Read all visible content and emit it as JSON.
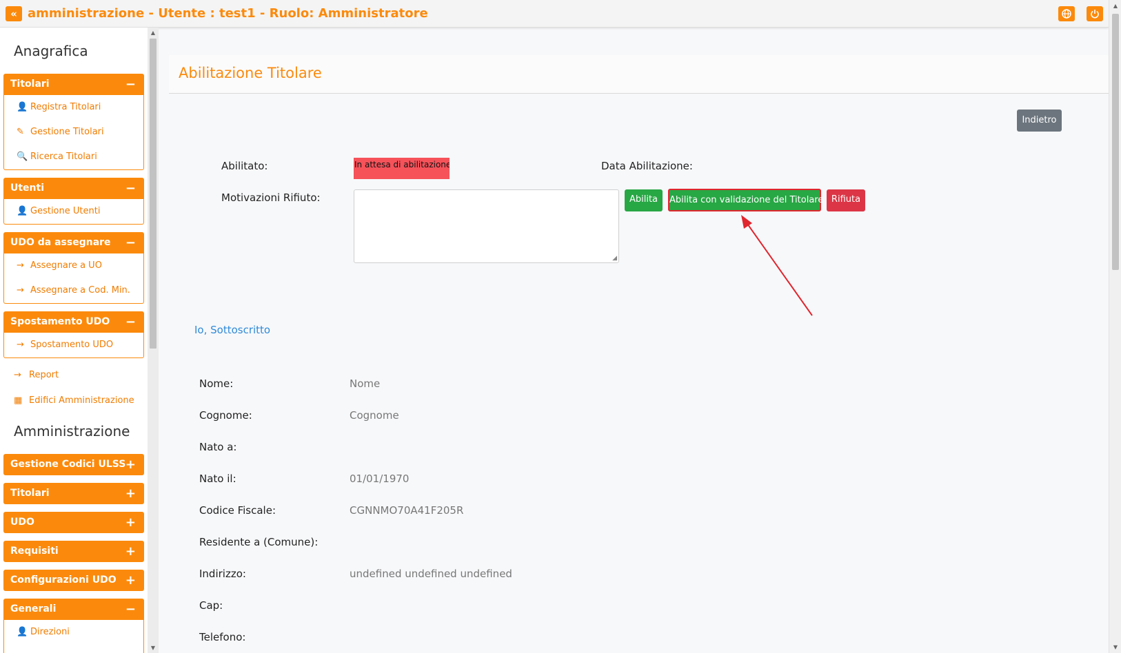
{
  "header": {
    "title": "amministrazione - Utente : test1 - Ruolo: Amministratore",
    "collapse_icon": "«"
  },
  "sidebar": {
    "section1": "Anagrafica",
    "section2": "Amministrazione",
    "groups": [
      {
        "title": "Titolari",
        "sign": "−",
        "items": [
          "Registra Titolari",
          "Gestione Titolari",
          "Ricerca Titolari"
        ]
      },
      {
        "title": "Utenti",
        "sign": "−",
        "items": [
          "Gestione Utenti"
        ]
      },
      {
        "title": "UDO da assegnare",
        "sign": "−",
        "items": [
          "Assegnare a UO",
          "Assegnare a Cod. Min."
        ]
      },
      {
        "title": "Spostamento UDO",
        "sign": "−",
        "items": [
          "Spostamento UDO"
        ]
      }
    ],
    "plain": [
      "Report",
      "Edifici Amministrazione"
    ],
    "admin_groups": [
      {
        "title": "Gestione Codici ULSS",
        "sign": "+"
      },
      {
        "title": "Titolari",
        "sign": "+"
      },
      {
        "title": "UDO",
        "sign": "+"
      },
      {
        "title": "Requisiti",
        "sign": "+"
      },
      {
        "title": "Configurazioni UDO",
        "sign": "+"
      },
      {
        "title": "Generali",
        "sign": "−",
        "items": [
          "Direzioni"
        ]
      }
    ]
  },
  "main": {
    "title": "Abilitazione Titolare",
    "back_label": "Indietro",
    "abilitato_label": "Abilitato:",
    "abilitato_value": "In attesa di abilitazione",
    "data_label": "Data Abilitazione:",
    "motivazioni_label": "Motivazioni Rifiuto:",
    "motivazioni_value": "",
    "btn_abilita": "Abilita",
    "btn_validazione": "Abilita con validazione del Titolare",
    "btn_rifiuta": "Rifiuta",
    "sottoscritto_link": "Io, Sottoscritto",
    "fields": [
      {
        "label": "Nome:",
        "value": "Nome"
      },
      {
        "label": "Cognome:",
        "value": "Cognome"
      },
      {
        "label": "Nato a:",
        "value": ""
      },
      {
        "label": "Nato il:",
        "value": "01/01/1970"
      },
      {
        "label": "Codice Fiscale:",
        "value": "CGNNMO70A41F205R"
      },
      {
        "label": "Residente a (Comune):",
        "value": ""
      },
      {
        "label": "Indirizzo:",
        "value": "undefined undefined undefined"
      },
      {
        "label": "Cap:",
        "value": ""
      },
      {
        "label": "Telefono:",
        "value": ""
      }
    ]
  },
  "colors": {
    "accent": "#fb8a0c",
    "success": "#28a745",
    "danger": "#dc3545",
    "secondary": "#6c757d",
    "annotation": "#e0262e"
  }
}
